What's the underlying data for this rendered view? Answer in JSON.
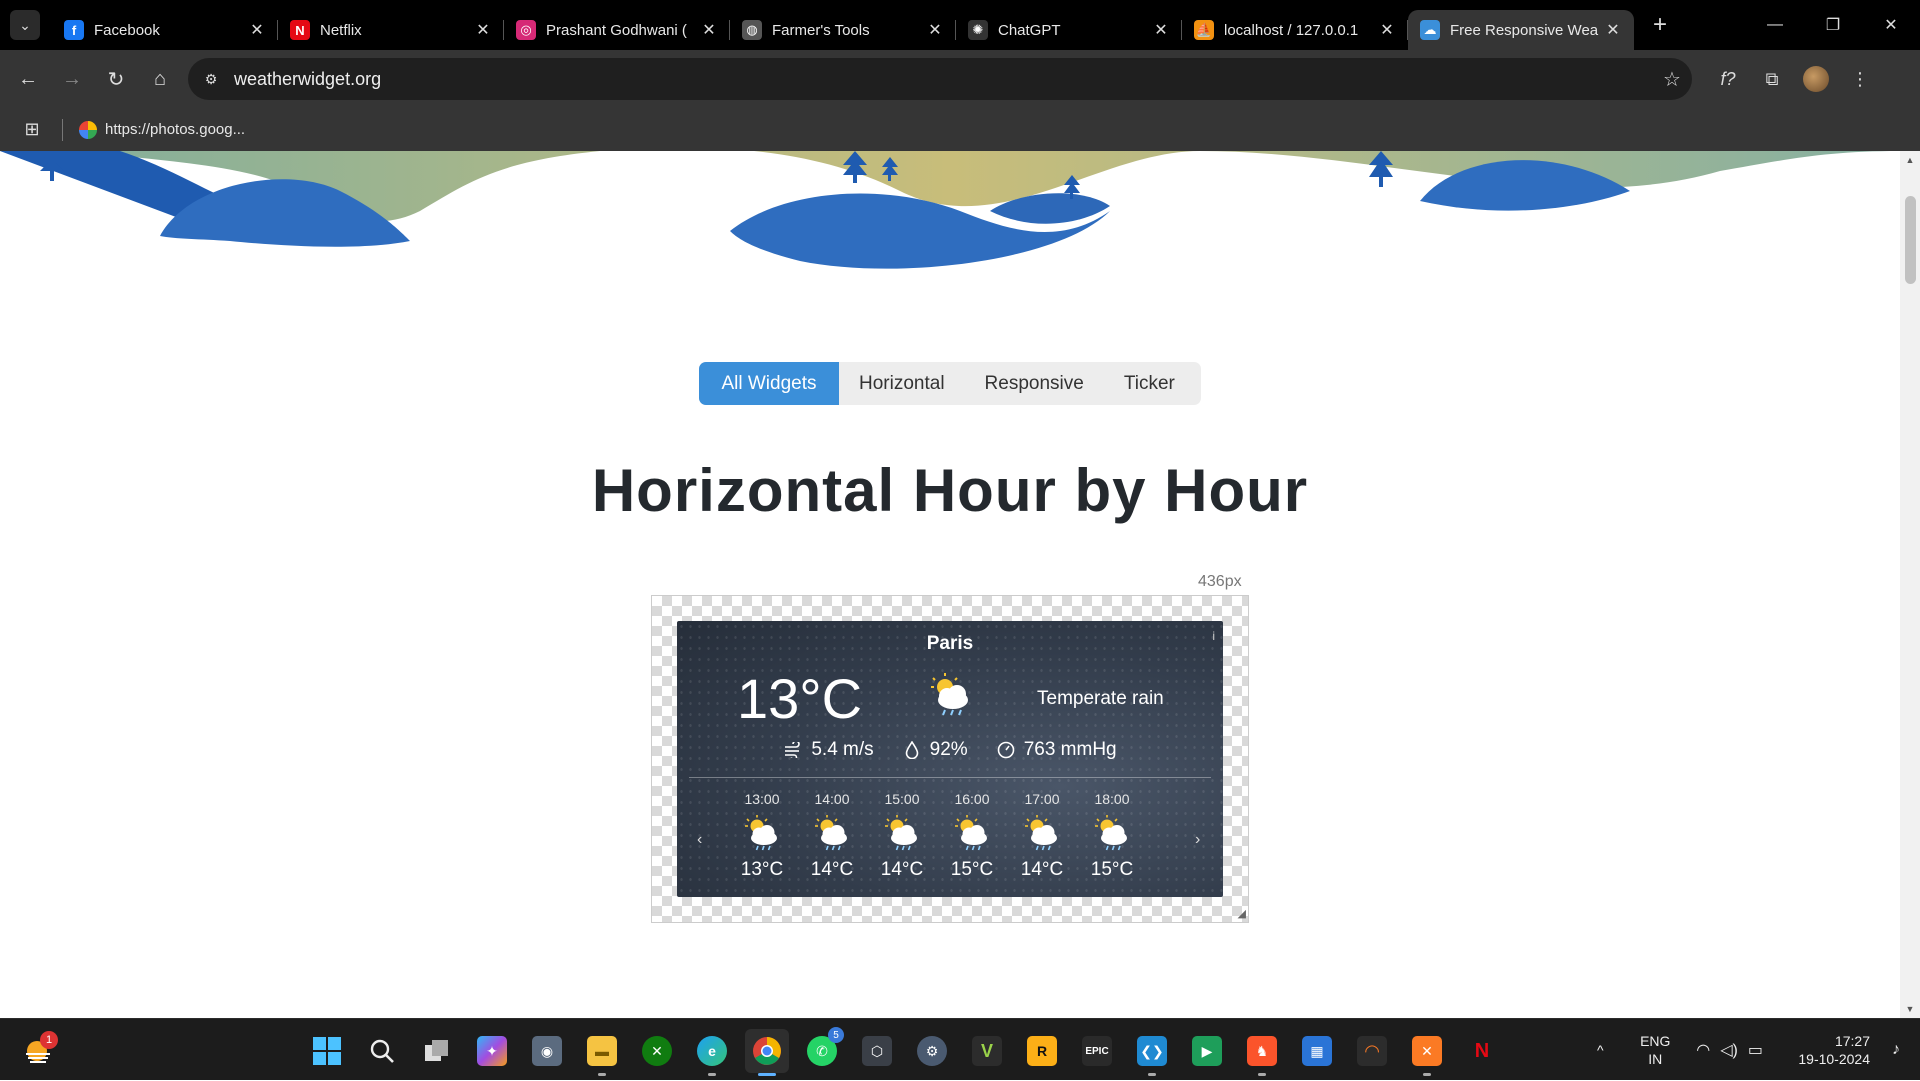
{
  "browser": {
    "tabs": [
      {
        "title": "Facebook",
        "icon": "facebook-icon",
        "color": "#1877f2",
        "glyph": "f"
      },
      {
        "title": "Netflix",
        "icon": "netflix-icon",
        "color": "#e50914",
        "glyph": "N"
      },
      {
        "title": "Prashant Godhwani (",
        "icon": "instagram-icon",
        "color": "#d62976",
        "glyph": "◎"
      },
      {
        "title": "Farmer's Tools",
        "icon": "globe-icon",
        "color": "#555555",
        "glyph": "◍"
      },
      {
        "title": "ChatGPT",
        "icon": "chatgpt-icon",
        "color": "#333333",
        "glyph": "✺"
      },
      {
        "title": "localhost / 127.0.0.1",
        "icon": "phpmyadmin-icon",
        "color": "#f29111",
        "glyph": "⛵"
      },
      {
        "title": "Free Responsive Wea",
        "icon": "weatherwidget-icon",
        "color": "#3b8fd9",
        "glyph": "☁",
        "active": true
      }
    ],
    "url": "weatherwidget.org",
    "bookmark": "https://photos.goog..."
  },
  "page": {
    "nav_tabs": [
      "All Widgets",
      "Horizontal",
      "Responsive",
      "Ticker"
    ],
    "active_tab": "All Widgets",
    "heading": "Horizontal Hour by Hour",
    "width_label": "436px",
    "widget": {
      "city": "Paris",
      "temperature": "13°C",
      "condition": "Temperate rain",
      "wind": "5.4 m/s",
      "humidity": "92%",
      "pressure": "763 mmHg",
      "hours": [
        {
          "time": "13:00",
          "temp": "13°C"
        },
        {
          "time": "14:00",
          "temp": "14°C"
        },
        {
          "time": "15:00",
          "temp": "14°C"
        },
        {
          "time": "16:00",
          "temp": "15°C"
        },
        {
          "time": "17:00",
          "temp": "14°C"
        },
        {
          "time": "18:00",
          "temp": "15°C"
        }
      ],
      "prev_arrow": "‹",
      "next_arrow": "›"
    }
  },
  "taskbar": {
    "weather_badge": "1",
    "whatsapp_badge": "5",
    "language": "ENG",
    "region": "IN",
    "time": "17:27",
    "date": "19-10-2024"
  },
  "colors": {
    "accent": "#3b8fd9",
    "widget_bg": "#333d4c",
    "heading": "#24292e"
  }
}
